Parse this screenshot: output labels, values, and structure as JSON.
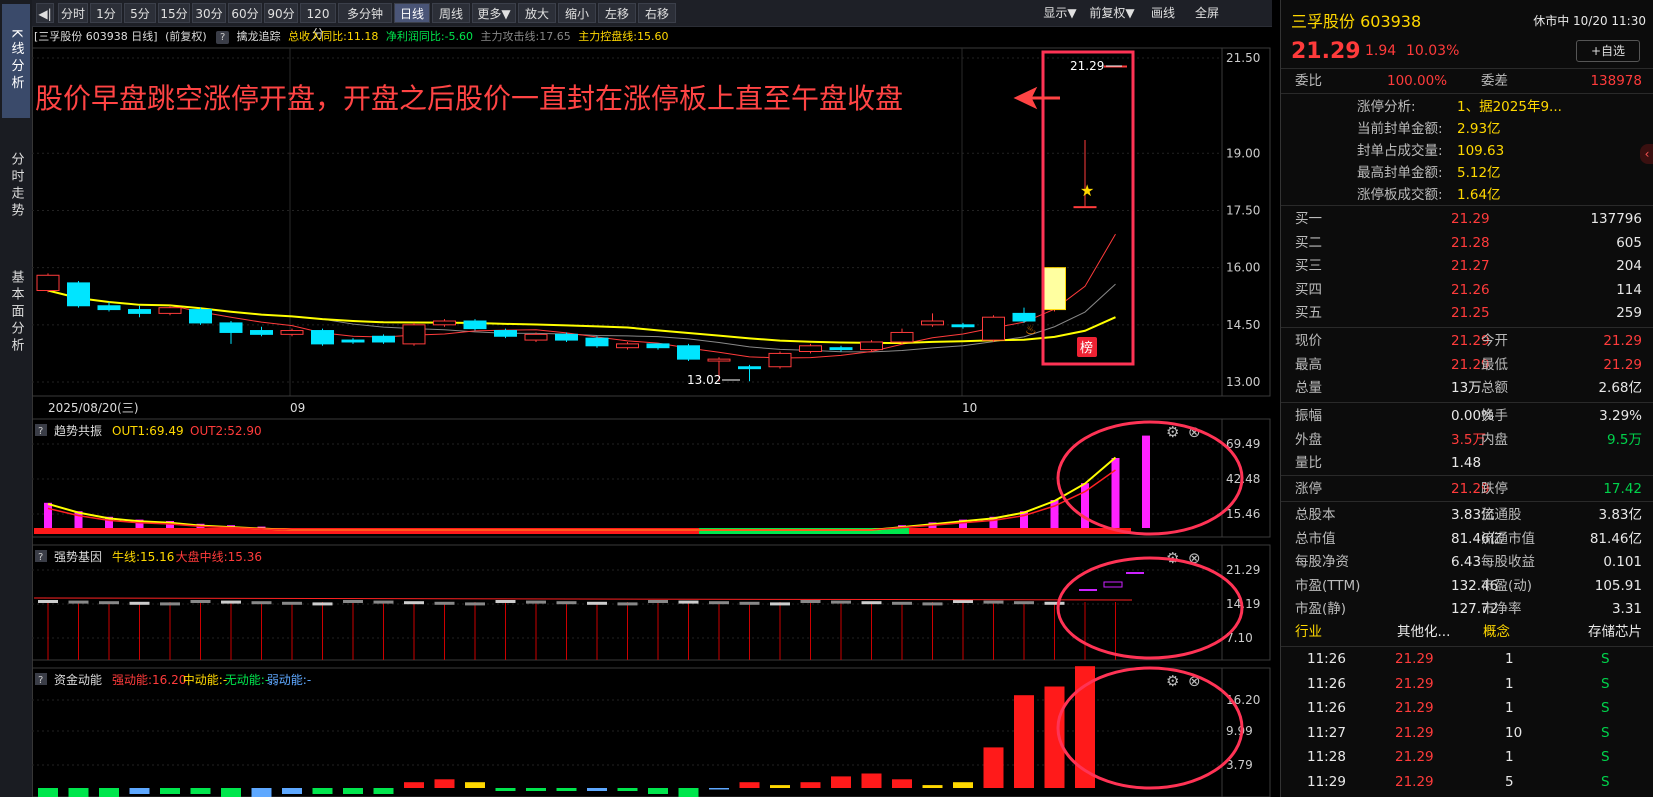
{
  "nav": [
    {
      "label": "K线分析",
      "active": true
    },
    {
      "label": "分时走势",
      "active": false
    },
    {
      "label": "基本面分析",
      "active": false
    }
  ],
  "toolbar": {
    "buttons": [
      "分时",
      "1分",
      "5分",
      "15分",
      "30分",
      "60分",
      "90分",
      "120分",
      "多分钟",
      "日线",
      "周线",
      "更多▼",
      "放大",
      "缩小",
      "左移",
      "右移"
    ],
    "active": "日线",
    "right_buttons": [
      "显示▼",
      "前复权▼",
      "画线",
      "全屏"
    ]
  },
  "info": {
    "stock": "[三孚股份 603938 日线]",
    "adj": "(前复权)",
    "indicator": "擒龙追踪",
    "rev": "总收入同比:11.18",
    "profit": "净利润同比:-5.60",
    "attack": "主力攻击线:17.65",
    "control": "主力控盘线:15.60"
  },
  "annotation": "股价早盘跳空涨停开盘，开盘之后股价一直封在涨停板上直至午盘收盘",
  "main_chart": {
    "y_labels": [
      "21.50",
      "19.00",
      "17.50",
      "16.00",
      "14.50",
      "13.00"
    ],
    "high_label": "21.29",
    "low_label": "13.02",
    "dates": [
      "2025/08/20(三)",
      "09",
      "10"
    ],
    "badge": "榜"
  },
  "panel1": {
    "name": "趋势共振",
    "v1": "OUT1:69.49",
    "v2": "OUT2:52.90",
    "y_labels": [
      "69.49",
      "42.48",
      "15.46"
    ]
  },
  "panel2": {
    "name": "强势基因",
    "v1": "牛线:15.16",
    "v2": "大盘中线:15.36",
    "y_labels": [
      "21.29",
      "14.19",
      "7.10"
    ]
  },
  "panel3": {
    "name": "资金动能",
    "v1": "强动能:16.20",
    "v2": "中动能:-",
    "v3": "无动能:-",
    "v4": "弱动能:-",
    "y_labels": [
      "16.20",
      "9.99",
      "3.79"
    ]
  },
  "chart_data": {
    "type": "candlestick",
    "bars": [
      {
        "o": 15.8,
        "c": 15.4,
        "h": 15.85,
        "l": 15.35,
        "up": true
      },
      {
        "o": 15.6,
        "c": 15.0,
        "h": 15.65,
        "l": 14.95,
        "up": false
      },
      {
        "o": 15.0,
        "c": 14.9,
        "h": 15.1,
        "l": 14.85,
        "up": false
      },
      {
        "o": 14.9,
        "c": 14.8,
        "h": 15.0,
        "l": 14.7,
        "up": false
      },
      {
        "o": 14.8,
        "c": 14.95,
        "h": 15.0,
        "l": 14.75,
        "up": true
      },
      {
        "o": 14.9,
        "c": 14.55,
        "h": 14.95,
        "l": 14.5,
        "up": false
      },
      {
        "o": 14.55,
        "c": 14.3,
        "h": 14.6,
        "l": 14.0,
        "up": false
      },
      {
        "o": 14.35,
        "c": 14.25,
        "h": 14.45,
        "l": 14.2,
        "up": false
      },
      {
        "o": 14.25,
        "c": 14.35,
        "h": 14.4,
        "l": 14.2,
        "up": true
      },
      {
        "o": 14.35,
        "c": 14.0,
        "h": 14.4,
        "l": 13.95,
        "up": false
      },
      {
        "o": 14.05,
        "c": 14.1,
        "h": 14.15,
        "l": 14.0,
        "up": false
      },
      {
        "o": 14.05,
        "c": 14.2,
        "h": 14.25,
        "l": 14.0,
        "up": false
      },
      {
        "o": 14.0,
        "c": 14.5,
        "h": 14.55,
        "l": 13.95,
        "up": true
      },
      {
        "o": 14.6,
        "c": 14.5,
        "h": 14.65,
        "l": 14.45,
        "up": true
      },
      {
        "o": 14.6,
        "c": 14.4,
        "h": 14.65,
        "l": 14.35,
        "up": false
      },
      {
        "o": 14.35,
        "c": 14.2,
        "h": 14.4,
        "l": 14.15,
        "up": false
      },
      {
        "o": 14.1,
        "c": 14.25,
        "h": 14.3,
        "l": 14.05,
        "up": true
      },
      {
        "o": 14.25,
        "c": 14.1,
        "h": 14.3,
        "l": 14.05,
        "up": false
      },
      {
        "o": 14.15,
        "c": 13.95,
        "h": 14.2,
        "l": 13.9,
        "up": false
      },
      {
        "o": 14.0,
        "c": 13.9,
        "h": 14.05,
        "l": 13.85,
        "up": true
      },
      {
        "o": 14.0,
        "c": 13.9,
        "h": 14.0,
        "l": 13.85,
        "up": false
      },
      {
        "o": 13.95,
        "c": 13.6,
        "h": 14.0,
        "l": 13.55,
        "up": false
      },
      {
        "o": 13.6,
        "c": 13.55,
        "h": 13.65,
        "l": 13.02,
        "up": true
      },
      {
        "o": 13.4,
        "c": 13.35,
        "h": 13.45,
        "l": 13.02,
        "up": false
      },
      {
        "o": 13.4,
        "c": 13.75,
        "h": 13.8,
        "l": 13.35,
        "up": true
      },
      {
        "o": 13.8,
        "c": 13.95,
        "h": 14.0,
        "l": 13.75,
        "up": true
      },
      {
        "o": 13.85,
        "c": 13.9,
        "h": 13.95,
        "l": 13.8,
        "up": false
      },
      {
        "o": 13.85,
        "c": 14.05,
        "h": 14.1,
        "l": 13.8,
        "up": true
      },
      {
        "o": 14.05,
        "c": 14.3,
        "h": 14.4,
        "l": 14.0,
        "up": true
      },
      {
        "o": 14.5,
        "c": 14.6,
        "h": 14.8,
        "l": 14.45,
        "up": true
      },
      {
        "o": 14.5,
        "c": 14.45,
        "h": 14.55,
        "l": 14.4,
        "up": false
      },
      {
        "o": 14.1,
        "c": 14.7,
        "h": 14.75,
        "l": 14.05,
        "up": true
      },
      {
        "o": 14.6,
        "c": 14.8,
        "h": 14.95,
        "l": 14.55,
        "up": false
      },
      {
        "o": 14.9,
        "c": 16.0,
        "h": 16.0,
        "l": 14.85,
        "up": true
      },
      {
        "o": 17.6,
        "c": 17.6,
        "h": 19.35,
        "l": 17.6,
        "up": true
      },
      {
        "o": 21.29,
        "c": 21.29,
        "h": 21.29,
        "l": 21.29,
        "up": true
      }
    ]
  },
  "quote": {
    "title": "三孚股份 603938",
    "status": "休市中 10/20 11:30",
    "price": "21.29",
    "change": "1.94",
    "pct": "10.03%",
    "fav": "+自选",
    "weibi_label": "委比",
    "weibi": "100.00%",
    "weicha_label": "委差",
    "weicha": "138978",
    "zt": [
      {
        "label": "涨停分析:",
        "value": "1、据2025年9..."
      },
      {
        "label": "当前封单金额:",
        "value": "2.93亿"
      },
      {
        "label": "封单占成交量:",
        "value": "109.63"
      },
      {
        "label": "最高封单金额:",
        "value": "5.12亿"
      },
      {
        "label": "涨停板成交额:",
        "value": "1.64亿"
      }
    ],
    "buy": [
      {
        "label": "买一",
        "price": "21.29",
        "vol": "137796"
      },
      {
        "label": "买二",
        "price": "21.28",
        "vol": "605"
      },
      {
        "label": "买三",
        "price": "21.27",
        "vol": "204"
      },
      {
        "label": "买四",
        "price": "21.26",
        "vol": "114"
      },
      {
        "label": "买五",
        "price": "21.25",
        "vol": "259"
      }
    ],
    "stats": [
      {
        "l1": "现价",
        "v1": "21.29",
        "c1": "red",
        "l2": "今开",
        "v2": "21.29",
        "c2": "red"
      },
      {
        "l1": "最高",
        "v1": "21.29",
        "c1": "red",
        "l2": "最低",
        "v2": "21.29",
        "c2": "red"
      },
      {
        "l1": "总量",
        "v1": "13万",
        "c1": "white",
        "l2": "总额",
        "v2": "2.68亿",
        "c2": "white"
      }
    ],
    "stats2": [
      {
        "l1": "振幅",
        "v1": "0.00%",
        "c1": "white",
        "l2": "换手",
        "v2": "3.29%",
        "c2": "white"
      },
      {
        "l1": "外盘",
        "v1": "3.5万",
        "c1": "red",
        "l2": "内盘",
        "v2": "9.5万",
        "c2": "green"
      },
      {
        "l1": "量比",
        "v1": "1.48",
        "c1": "white",
        "l2": "",
        "v2": "",
        "c2": "white"
      }
    ],
    "limits": {
      "l1": "涨停",
      "v1": "21.29",
      "l2": "跌停",
      "v2": "17.42"
    },
    "fund": [
      {
        "l1": "总股本",
        "v1": "3.83亿",
        "l2": "流通股",
        "v2": "3.83亿"
      },
      {
        "l1": "总市值",
        "v1": "81.46亿",
        "l2": "流通市值",
        "v2": "81.46亿"
      },
      {
        "l1": "每股净资",
        "v1": "6.43",
        "l2": "每股收益",
        "v2": "0.101"
      },
      {
        "l1": "市盈(TTM)",
        "v1": "132.46",
        "l2": "市盈(动)",
        "v2": "105.91"
      },
      {
        "l1": "市盈(静)",
        "v1": "127.72",
        "l2": "市净率",
        "v2": "3.31"
      }
    ],
    "industry": {
      "l1": "行业",
      "v1": "其他化...",
      "l2": "概念",
      "v2": "存储芯片"
    },
    "ticks": [
      {
        "t": "11:26",
        "p": "21.29",
        "v": "1",
        "s": "S"
      },
      {
        "t": "11:26",
        "p": "21.29",
        "v": "1",
        "s": "S"
      },
      {
        "t": "11:26",
        "p": "21.29",
        "v": "1",
        "s": "S"
      },
      {
        "t": "11:27",
        "p": "21.29",
        "v": "10",
        "s": "S"
      },
      {
        "t": "11:28",
        "p": "21.29",
        "v": "1",
        "s": "S"
      },
      {
        "t": "11:29",
        "p": "21.29",
        "v": "5",
        "s": "S"
      }
    ]
  },
  "colors": {
    "up": "#ff3b3b",
    "down": "#00e5ff",
    "ma_yellow": "#ffff00",
    "highlight": "#ff3355"
  }
}
